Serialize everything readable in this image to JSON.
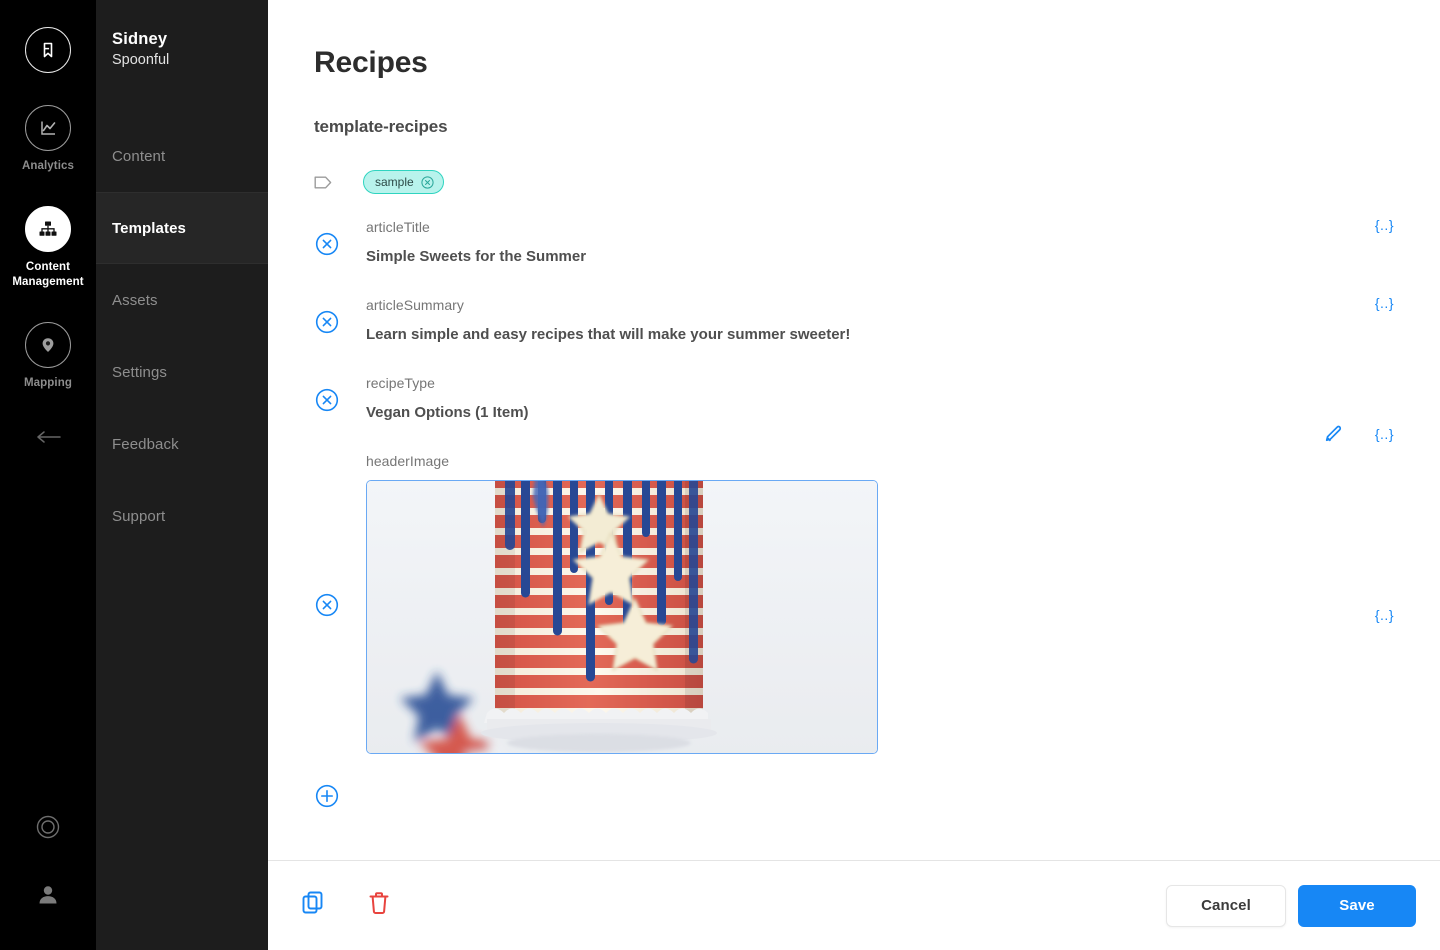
{
  "rail": {
    "logo_icon": "bookmark-logo-icon",
    "items": [
      {
        "label": "Analytics",
        "icon": "line-chart-icon",
        "active": false
      },
      {
        "label": "Content Management",
        "icon": "sitemap-icon",
        "active": true
      },
      {
        "label": "Mapping",
        "icon": "map-pin-icon",
        "active": false
      }
    ],
    "collapse_icon": "arrow-left-icon",
    "help_icon": "lifebuoy-icon",
    "account_icon": "user-avatar-icon"
  },
  "subnav": {
    "account_name": "Sidney",
    "account_sub": "Spoonful",
    "items": [
      {
        "label": "Content",
        "active": false
      },
      {
        "label": "Templates",
        "active": true
      },
      {
        "label": "Assets",
        "active": false
      },
      {
        "label": "Settings",
        "active": false
      },
      {
        "label": "Feedback",
        "active": false
      },
      {
        "label": "Support",
        "active": false
      }
    ]
  },
  "main": {
    "page_title": "Recipes",
    "template_name": "template-recipes",
    "tag_icon": "tag-icon",
    "tags": [
      {
        "label": "sample",
        "remove_icon": "circle-x-icon"
      }
    ],
    "fields": [
      {
        "name": "articleTitle",
        "value": "Simple Sweets for the Summer",
        "remove_icon": "circle-x-icon",
        "token_label": "{..}",
        "has_edit": false
      },
      {
        "name": "articleSummary",
        "value": "Learn simple and easy recipes that will make your summer sweeter!",
        "remove_icon": "circle-x-icon",
        "token_label": "{..}",
        "has_edit": false
      },
      {
        "name": "recipeType",
        "value": "Vegan Options (1 Item)",
        "remove_icon": "circle-x-icon",
        "token_label": "{..}",
        "has_edit": true,
        "edit_icon": "pencil-icon"
      },
      {
        "name": "headerImage",
        "value": "",
        "remove_icon": "circle-x-icon",
        "token_label": "{..}",
        "has_edit": false,
        "image_alt": "patriotic-striped-cake-photo"
      }
    ],
    "add_field_icon": "circle-plus-icon"
  },
  "bottombar": {
    "duplicate_icon": "copy-icon",
    "delete_icon": "trash-icon",
    "cancel_label": "Cancel",
    "save_label": "Save"
  },
  "colors": {
    "accent_blue": "#1787f5",
    "danger_red": "#e8433e",
    "tag_teal_border": "#2fd4c0",
    "tag_teal_fill": "#b8f3ec",
    "rail_black": "#000000",
    "subnav_dark": "#1d1d1d"
  }
}
